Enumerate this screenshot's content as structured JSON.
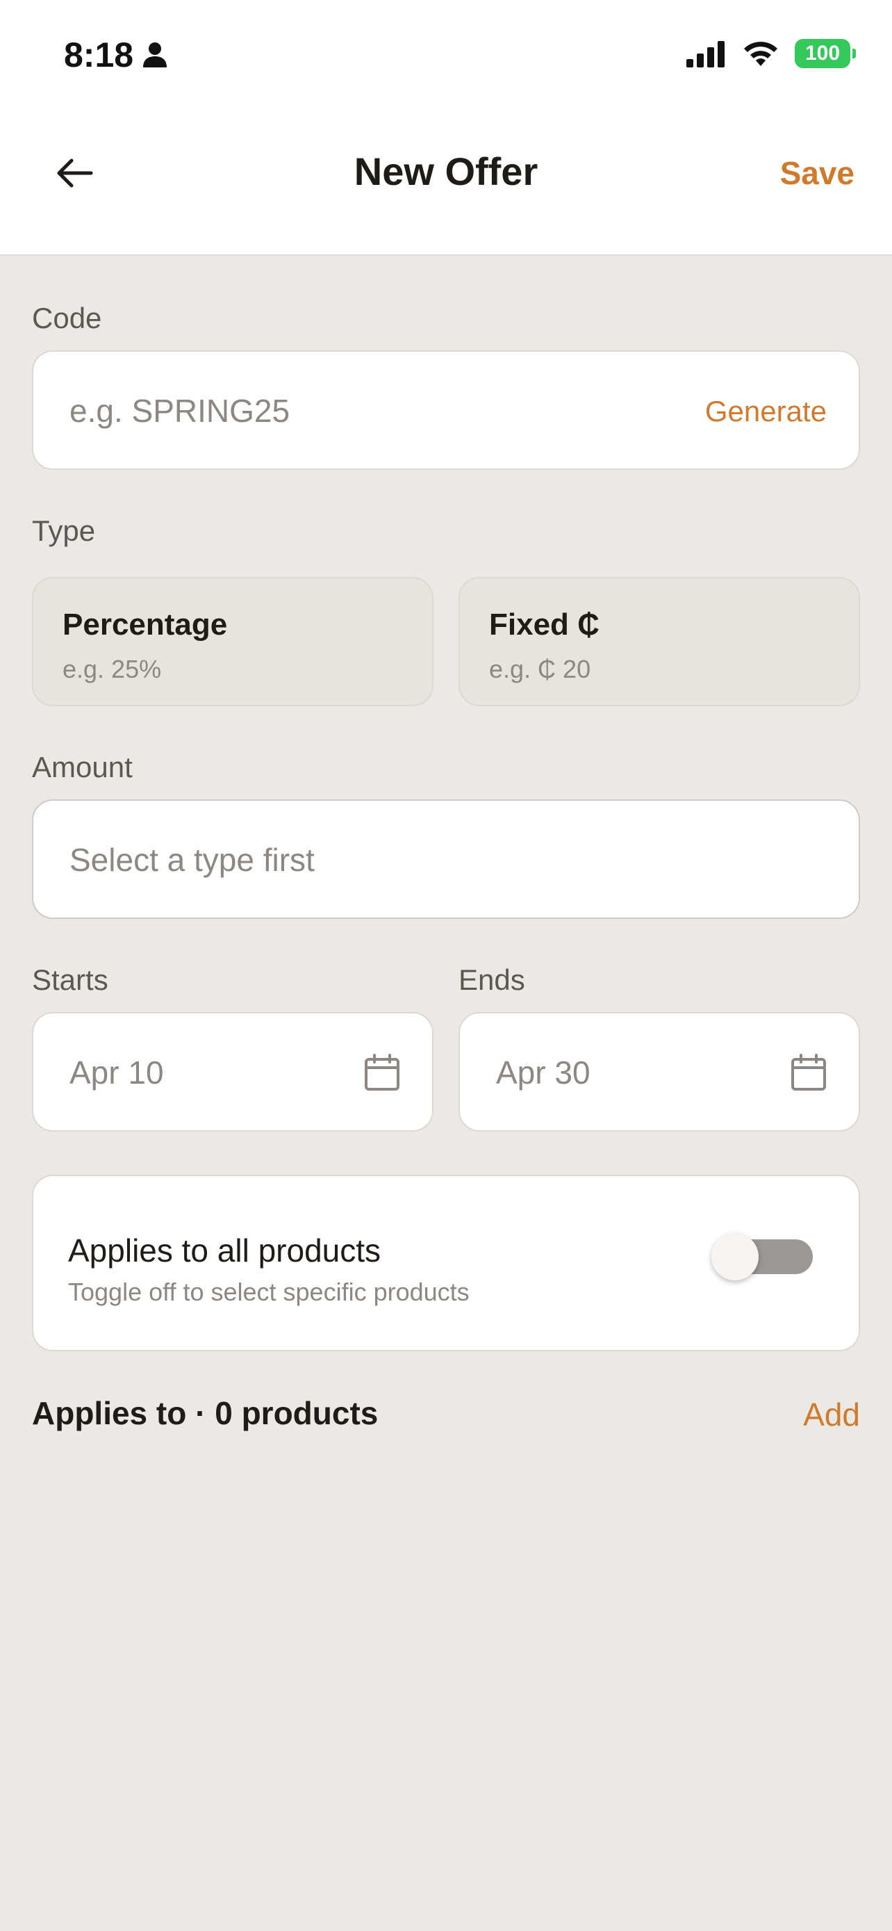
{
  "status_bar": {
    "time": "8:18",
    "battery": "100"
  },
  "header": {
    "title": "New Offer",
    "save_label": "Save"
  },
  "code": {
    "label": "Code",
    "placeholder": "e.g. SPRING25",
    "generate_label": "Generate"
  },
  "type": {
    "label": "Type",
    "options": [
      {
        "title": "Percentage",
        "example": "e.g. 25%"
      },
      {
        "title": "Fixed ₵",
        "example": "e.g. ₵ 20"
      }
    ]
  },
  "amount": {
    "label": "Amount",
    "placeholder": "Select a type first"
  },
  "starts": {
    "label": "Starts",
    "value": "Apr 10"
  },
  "ends": {
    "label": "Ends",
    "value": "Apr 30"
  },
  "applies_all": {
    "title": "Applies to all products",
    "subtitle": "Toggle off to select specific products",
    "enabled": false
  },
  "applies_to": {
    "title": "Applies to · 0 products",
    "add_label": "Add"
  },
  "colors": {
    "accent": "#d07a2e",
    "background": "#ebe9e6"
  }
}
